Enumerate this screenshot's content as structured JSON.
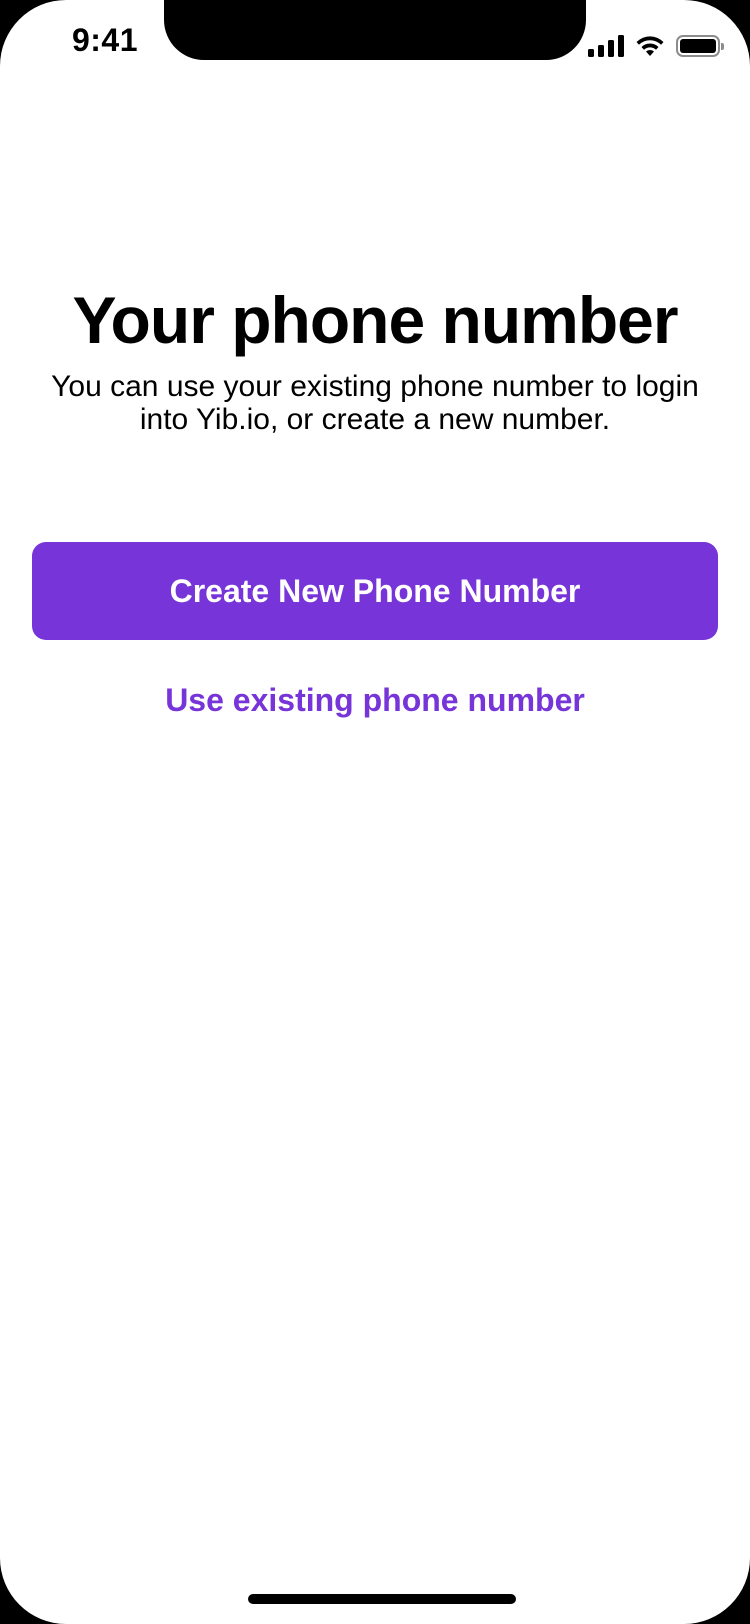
{
  "status_bar": {
    "time": "9:41",
    "icons": [
      "cellular-signal-icon",
      "wifi-icon",
      "battery-icon"
    ]
  },
  "main": {
    "title": "Your phone number",
    "subtitle": "You can use your existing phone number to login into Yib.io, or create a new number.",
    "primary_button_label": "Create New Phone Number",
    "secondary_link_label": "Use existing phone number"
  },
  "colors": {
    "accent": "#7634D9",
    "background": "#FFFFFF",
    "text": "#000000"
  }
}
